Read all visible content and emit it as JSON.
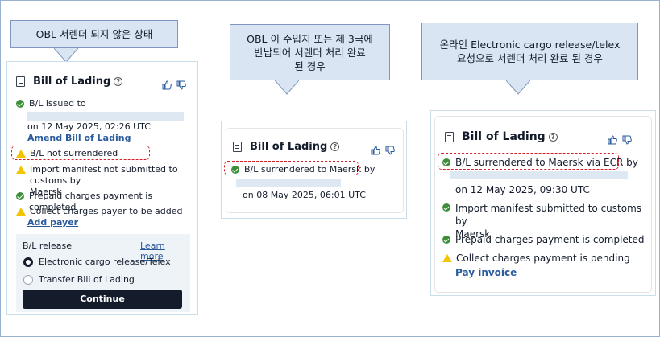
{
  "callouts": {
    "c1": "OBL 서렌더 되지 않은 상태",
    "c2_line1": "OBL 이 수입지 또는 제 3국에",
    "c2_line2": "반납되어 서렌더 처리 완료",
    "c2_line3": "된 경우",
    "c3_line1": "온라인 Electronic cargo release/telex",
    "c3_line2": "요청으로 서렌더 처리 완료 된 경우"
  },
  "card1": {
    "title": "Bill of Lading",
    "issued_label": "B/L issued to",
    "issued_date": "on 12 May 2025, 02:26 UTC",
    "amend_link": "Amend Bill of Lading",
    "not_surrendered": "B/L not surrendered",
    "import_manifest_line1": "Import manifest not submitted to customs by",
    "import_manifest_line2": "Maersk",
    "prepaid": "Prepaid charges payment is completed",
    "collect": "Collect charges payer to be added",
    "add_payer_link": "Add payer",
    "release_label": "B/L release",
    "learn_more": "Learn more",
    "option_ecr": "Electronic cargo release/Telex",
    "option_transfer": "Transfer Bill of Lading",
    "continue_label": "Continue"
  },
  "card2": {
    "title": "Bill of Lading",
    "surrendered": "B/L surrendered to Maersk by",
    "date": "on 08 May 2025, 06:01 UTC"
  },
  "card3": {
    "title": "Bill of Lading",
    "surrendered": "B/L surrendered to Maersk via ECR by",
    "date": "on 12 May 2025, 09:30 UTC",
    "import_manifest_line1": "Import manifest submitted to customs by",
    "import_manifest_line2": "Maersk",
    "prepaid": "Prepaid charges payment is completed",
    "collect": "Collect charges payment is pending",
    "pay_link": "Pay invoice"
  },
  "colors": {
    "callout_bg": "#dae5f3",
    "highlight_dash": "#d5202a",
    "success": "#3d8f3a",
    "warning": "#f5c400",
    "link": "#2a5b9c",
    "button": "#141c2c"
  }
}
